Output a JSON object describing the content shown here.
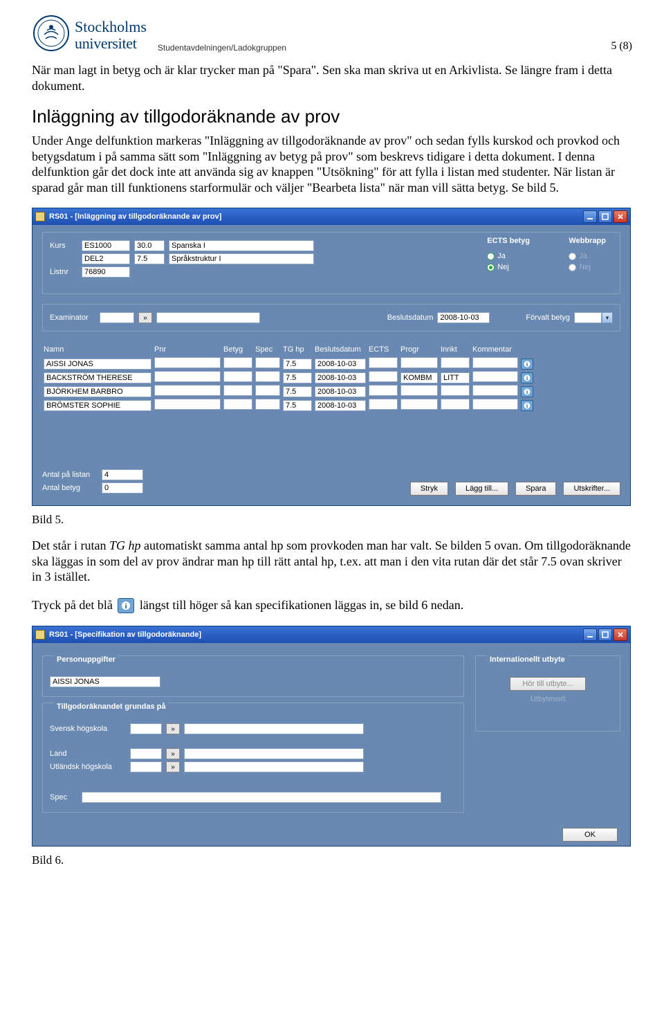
{
  "header": {
    "brand_line1": "Stockholms",
    "brand_line2": "universitet",
    "dept": "Studentavdelningen/Ladokgruppen",
    "page_num": "5 (8)"
  },
  "paragraphs": {
    "p1": "När man lagt in betyg och är klar trycker man på \"Spara\". Sen ska man skriva ut en Arkivlista. Se längre fram i detta dokument.",
    "h2": "Inläggning av tillgodoräknande av prov",
    "p2": "Under Ange delfunktion markeras \"Inläggning av tillgodoräknande av prov\" och sedan fylls kurskod och provkod och betygsdatum i på samma sätt som \"Inläggning av betyg på prov\" som beskrevs tidigare i detta dokument. I denna delfunktion går det dock inte att använda sig av knappen \"Utsökning\" för att fylla i listan med studenter. När listan är sparad går man till funktionens starformulär och väljer \"Bearbeta lista\" när man vill sätta betyg. Se bild 5.",
    "cap5": "Bild 5.",
    "p3a": "Det står i rutan ",
    "p3b_italic": "TG hp",
    "p3c": " automatiskt samma antal hp som provkoden man har valt. Se bilden 5 ovan. Om tillgodoräknande ska läggas in som del av prov ändrar man hp till rätt antal hp, t.ex. att man i den vita rutan där det står 7.5 ovan skriver in 3 istället.",
    "p4a": "Tryck på det blå ",
    "p4b": " längst till höger så kan specifikationen läggas in, se bild 6 nedan.",
    "cap6": "Bild 6."
  },
  "win1": {
    "title": "RS01 - [Inläggning av tillgodoräknande av prov]",
    "kurs_lbl": "Kurs",
    "kurs1": "ES1000",
    "kurs1_hp": "30.0",
    "kurs1_name": "Spanska I",
    "kurs2": "DEL2",
    "kurs2_hp": "7.5",
    "kurs2_name": "Språkstruktur I",
    "listnr_lbl": "Listnr",
    "listnr": "76890",
    "ects_title": "ECTS betyg",
    "webb_title": "Webbrapp",
    "opt_ja": "Ja",
    "opt_nej": "Nej",
    "exam_lbl": "Examinator",
    "beslut_lbl": "Beslutsdatum",
    "beslut_val": "2008-10-03",
    "forvalt_lbl": "Förvalt betyg",
    "columns": {
      "namn": "Namn",
      "pnr": "Pnr",
      "betyg": "Betyg",
      "spec": "Spec",
      "tghp": "TG hp",
      "beslut": "Beslutsdatum",
      "ects": "ECTS",
      "progr": "Progr",
      "inrikt": "Inrikt",
      "komm": "Kommentar"
    },
    "rows": [
      {
        "namn": "AISSI JONAS",
        "tghp": "7.5",
        "date": "2008-10-03",
        "progr": "",
        "inrikt": ""
      },
      {
        "namn": "BACKSTRÖM THERESE",
        "tghp": "7.5",
        "date": "2008-10-03",
        "progr": "KOMBM",
        "inrikt": "LITT"
      },
      {
        "namn": "BJÖRKHEM BARBRO",
        "tghp": "7.5",
        "date": "2008-10-03",
        "progr": "",
        "inrikt": ""
      },
      {
        "namn": "BRÖMSTER SOPHIE",
        "tghp": "7.5",
        "date": "2008-10-03",
        "progr": "",
        "inrikt": ""
      }
    ],
    "antal_list_lbl": "Antal på listan",
    "antal_list": "4",
    "antal_betyg_lbl": "Antal betyg",
    "antal_betyg": "0",
    "buttons": {
      "stryk": "Stryk",
      "lagg": "Lägg till...",
      "spara": "Spara",
      "utskrift": "Utskrifter..."
    }
  },
  "win2": {
    "title": "RS01 - [Specifikation av tillgodoräknande]",
    "pers_legend": "Personuppgifter",
    "pers_name": "AISSI JONAS",
    "grund_legend": "Tillgodoräknandet grundas på",
    "svensk_lbl": "Svensk högskola",
    "land_lbl": "Land",
    "utl_lbl": "Utländsk högskola",
    "spec_lbl": "Spec",
    "int_legend": "Internationellt utbyte",
    "hor_btn": "Hör till utbyte...",
    "utb_btn": "Utbytesort",
    "ok": "OK"
  }
}
